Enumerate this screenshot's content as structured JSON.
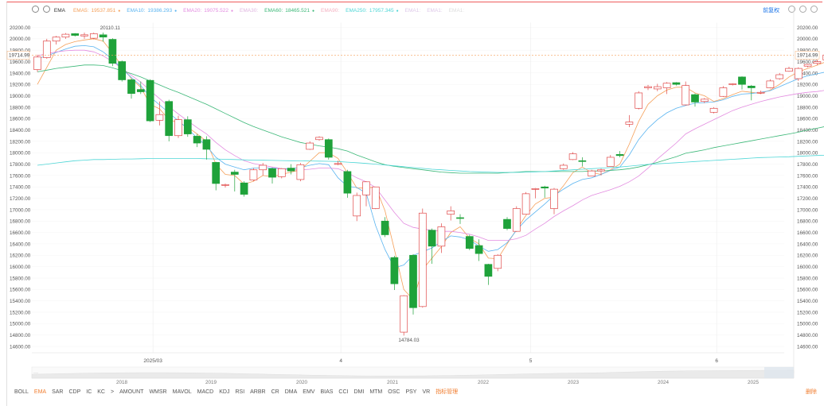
{
  "toolbar": {
    "indicator": "EMA",
    "items": [
      {
        "label": "EMA5:",
        "value": "19537.851",
        "color": "#f5a05a"
      },
      {
        "label": "EMA10:",
        "value": "19386.293",
        "color": "#5ab4f0"
      },
      {
        "label": "EMA20:",
        "value": "19075.522",
        "color": "#e38ce0"
      },
      {
        "label": "EMA30:",
        "value": "",
        "color": "#e0b6e0"
      },
      {
        "label": "EMA60:",
        "value": "18465.521",
        "color": "#3cb878"
      },
      {
        "label": "EMA90:",
        "value": "",
        "color": "#f4b0c0"
      },
      {
        "label": "EMA250:",
        "value": "17957.345",
        "color": "#4dd6d6"
      },
      {
        "label": "EMA1:",
        "value": "",
        "color": "#ddc8e8"
      },
      {
        "label": "EMA1:",
        "value": "",
        "color": "#ddc8e8"
      },
      {
        "label": "EMA1:",
        "value": "",
        "color": "#ddd"
      }
    ],
    "right_button": "前复权"
  },
  "chart_data": {
    "type": "candlestick",
    "ylim": [
      14500,
      20300
    ],
    "y_ticks": [
      "20200.00",
      "20000.00",
      "19800.00",
      "19600.00",
      "19400.00",
      "19200.00",
      "19000.00",
      "18800.00",
      "18600.00",
      "18400.00",
      "18200.00",
      "18000.00",
      "17800.00",
      "17600.00",
      "17400.00",
      "17200.00",
      "17000.00",
      "16800.00",
      "16600.00",
      "16400.00",
      "16200.00",
      "16000.00",
      "15800.00",
      "15600.00",
      "15400.00",
      "15200.00",
      "15000.00",
      "14800.00",
      "14600.00"
    ],
    "x_labels": [
      {
        "label": "2025/03",
        "i": 12.3
      },
      {
        "label": "4",
        "i": 32.3
      },
      {
        "label": "5",
        "i": 52.5
      },
      {
        "label": "6",
        "i": 72.3
      }
    ],
    "current_price": "19714.99",
    "current_value": 19714.99,
    "max_label": "20110.11",
    "max_index": 7,
    "min_label": "14784.03",
    "min_index": 38,
    "candles": [
      [
        19460,
        19680,
        19420,
        19720
      ],
      [
        19670,
        19960,
        19650,
        20000
      ],
      [
        19960,
        20030,
        19900,
        20050
      ],
      [
        20030,
        20080,
        20000,
        20100
      ],
      [
        20090,
        20060,
        20040,
        20100
      ],
      [
        20050,
        20070,
        20000,
        20110
      ],
      [
        20010,
        20090,
        19990,
        20110
      ],
      [
        20070,
        20030,
        19950,
        20110
      ],
      [
        19990,
        19570,
        19520,
        20010
      ],
      [
        19600,
        19280,
        19250,
        19620
      ],
      [
        19280,
        19040,
        18950,
        19300
      ],
      [
        19110,
        19070,
        19030,
        19250
      ],
      [
        19270,
        18560,
        18540,
        19290
      ],
      [
        18570,
        18670,
        18480,
        18900
      ],
      [
        18900,
        18300,
        18200,
        18930
      ],
      [
        18300,
        18580,
        18260,
        18650
      ],
      [
        18580,
        18330,
        18280,
        18640
      ],
      [
        18290,
        18170,
        18100,
        18330
      ],
      [
        18230,
        18060,
        17880,
        18290
      ],
      [
        17830,
        17460,
        17340,
        17840
      ],
      [
        17440,
        17440,
        17390,
        17460
      ],
      [
        17660,
        17620,
        17320,
        17700
      ],
      [
        17470,
        17270,
        17230,
        17500
      ],
      [
        17520,
        17700,
        17500,
        17730
      ],
      [
        17700,
        17780,
        17600,
        17820
      ],
      [
        17720,
        17570,
        17460,
        17740
      ],
      [
        17580,
        17720,
        17550,
        17730
      ],
      [
        17730,
        17680,
        17620,
        17800
      ],
      [
        17530,
        17790,
        17500,
        17820
      ],
      [
        18060,
        18170,
        18050,
        18200
      ],
      [
        18230,
        18270,
        18210,
        18290
      ],
      [
        18230,
        17920,
        17880,
        18250
      ],
      [
        17800,
        17810,
        17780,
        17860
      ],
      [
        17670,
        17290,
        17210,
        17700
      ],
      [
        16890,
        17250,
        16800,
        17300
      ],
      [
        17260,
        17490,
        17060,
        17500
      ],
      [
        17020,
        17400,
        17010,
        17400
      ],
      [
        16800,
        16560,
        16520,
        16870
      ],
      [
        16160,
        15700,
        15590,
        16190
      ],
      [
        14850,
        15490,
        14790,
        15500
      ],
      [
        16200,
        15280,
        15160,
        16220
      ],
      [
        15300,
        16940,
        15280,
        17020
      ],
      [
        16640,
        16360,
        16050,
        16670
      ],
      [
        16360,
        16700,
        16240,
        16760
      ],
      [
        16920,
        16980,
        16810,
        17060
      ],
      [
        16860,
        16850,
        16750,
        16920
      ],
      [
        16530,
        16320,
        16290,
        16560
      ],
      [
        16370,
        16230,
        16100,
        16480
      ],
      [
        16040,
        15830,
        15680,
        16050
      ],
      [
        15970,
        16200,
        15920,
        16220
      ],
      [
        16830,
        16670,
        16640,
        16870
      ],
      [
        16620,
        17020,
        16610,
        17060
      ],
      [
        16920,
        17280,
        16950,
        17310
      ],
      [
        17360,
        17370,
        17200,
        17380
      ],
      [
        17400,
        17380,
        17210,
        17420
      ],
      [
        17020,
        17360,
        16920,
        17380
      ],
      [
        17720,
        17780,
        17700,
        17810
      ],
      [
        17880,
        17980,
        17870,
        18010
      ],
      [
        17860,
        17850,
        17760,
        17920
      ],
      [
        17590,
        17680,
        17640,
        17700
      ],
      [
        17680,
        17700,
        17600,
        17720
      ],
      [
        17760,
        17920,
        17780,
        17960
      ],
      [
        17970,
        17950,
        17920,
        18030
      ],
      [
        18500,
        18540,
        18450,
        18660
      ],
      [
        18780,
        19050,
        18760,
        19080
      ],
      [
        19140,
        19160,
        19100,
        19190
      ],
      [
        19120,
        19160,
        19080,
        19210
      ],
      [
        19140,
        19220,
        19030,
        19240
      ],
      [
        19230,
        19200,
        19180,
        19240
      ],
      [
        18840,
        19180,
        18830,
        19250
      ],
      [
        19020,
        18890,
        18810,
        19040
      ],
      [
        18900,
        18940,
        18870,
        18960
      ],
      [
        18710,
        18780,
        18690,
        18800
      ],
      [
        18990,
        19140,
        18980,
        19170
      ],
      [
        19200,
        19210,
        19180,
        19220
      ],
      [
        19330,
        19200,
        19110,
        19340
      ],
      [
        19170,
        19140,
        18920,
        19190
      ],
      [
        19060,
        19060,
        19030,
        19090
      ],
      [
        19140,
        19260,
        19130,
        19290
      ],
      [
        19300,
        19370,
        19280,
        19400
      ],
      [
        19430,
        19480,
        19420,
        19510
      ],
      [
        19300,
        19480,
        19260,
        19500
      ],
      [
        19520,
        19550,
        19500,
        19560
      ],
      [
        19570,
        19600,
        19540,
        19630
      ],
      [
        19630,
        19715,
        19600,
        19730
      ]
    ],
    "ema_lines": [
      {
        "name": "EMA5",
        "color": "#f5a05a",
        "values": [
          19200,
          19500,
          19800,
          19900,
          19950,
          19980,
          20000,
          19960,
          19750,
          19520,
          19300,
          19150,
          18850,
          18770,
          18580,
          18530,
          18450,
          18330,
          18200,
          17800,
          17620,
          17600,
          17450,
          17500,
          17600,
          17580,
          17620,
          17660,
          17700,
          17850,
          18000,
          18000,
          17900,
          17650,
          17380,
          17380,
          17400,
          16980,
          16300,
          15600,
          15420,
          15950,
          16150,
          16350,
          16600,
          16700,
          16500,
          16400,
          16150,
          16140,
          16400,
          16650,
          16900,
          17100,
          17200,
          17220,
          17420,
          17650,
          17750,
          17650,
          17620,
          17700,
          17800,
          18150,
          18550,
          18850,
          19000,
          19100,
          19150,
          19150,
          19050,
          19000,
          18900,
          18950,
          19020,
          19080,
          19060,
          19040,
          19100,
          19200,
          19330,
          19420,
          19480,
          19537,
          19600
        ]
      },
      {
        "name": "EMA10",
        "color": "#5ab4f0",
        "values": [
          19650,
          19700,
          19760,
          19820,
          19870,
          19880,
          19860,
          19770,
          19640,
          19470,
          19320,
          19180,
          18980,
          18840,
          18700,
          18560,
          18420,
          18260,
          18120,
          17920,
          17800,
          17750,
          17700,
          17730,
          17740,
          17730,
          17720,
          17720,
          17740,
          17780,
          17810,
          17790,
          17560,
          17410,
          17390,
          17290,
          16720,
          16300,
          15980,
          16030,
          16200,
          16260,
          16330,
          16440,
          16540,
          16520,
          16470,
          16360,
          16270,
          16300,
          16420,
          16640,
          16820,
          16960,
          17100,
          17250,
          17360,
          17460,
          17530,
          17560,
          17620,
          17690,
          17750,
          17960,
          18230,
          18430,
          18580,
          18700,
          18780,
          18830,
          18870,
          18880,
          18890,
          18930,
          18990,
          19030,
          19040,
          19060,
          19090,
          19160,
          19230,
          19300,
          19350,
          19386,
          19420
        ]
      },
      {
        "name": "EMA20",
        "color": "#e38ce0",
        "values": [
          19700,
          19740,
          19770,
          19790,
          19800,
          19800,
          19770,
          19700,
          19600,
          19480,
          19360,
          19240,
          19090,
          18950,
          18810,
          18680,
          18560,
          18440,
          18330,
          18180,
          18050,
          17950,
          17860,
          17810,
          17780,
          17750,
          17720,
          17700,
          17700,
          17710,
          17730,
          17730,
          17720,
          17650,
          17560,
          17490,
          17390,
          17170,
          16950,
          16760,
          16690,
          16660,
          16640,
          16620,
          16620,
          16600,
          16570,
          16520,
          16460,
          16460,
          16460,
          16490,
          16550,
          16660,
          16760,
          16880,
          16980,
          17070,
          17170,
          17250,
          17300,
          17350,
          17410,
          17490,
          17590,
          17730,
          17890,
          18030,
          18170,
          18330,
          18420,
          18500,
          18580,
          18660,
          18740,
          18800,
          18850,
          18900,
          18940,
          18980,
          19010,
          19040,
          19060,
          19075,
          19100
        ]
      },
      {
        "name": "EMA60",
        "color": "#3cb878",
        "values": [
          19420,
          19450,
          19480,
          19500,
          19520,
          19540,
          19540,
          19530,
          19490,
          19440,
          19390,
          19330,
          19260,
          19190,
          19120,
          19060,
          18990,
          18920,
          18850,
          18770,
          18690,
          18610,
          18530,
          18460,
          18400,
          18340,
          18280,
          18230,
          18180,
          18150,
          18120,
          18100,
          18070,
          18030,
          17960,
          17900,
          17840,
          17790,
          17760,
          17740,
          17720,
          17700,
          17680,
          17660,
          17650,
          17640,
          17640,
          17640,
          17640,
          17640,
          17650,
          17660,
          17670,
          17670,
          17670,
          17670,
          17670,
          17670,
          17670,
          17680,
          17680,
          17690,
          17700,
          17720,
          17750,
          17790,
          17830,
          17880,
          17930,
          17990,
          18020,
          18050,
          18090,
          18120,
          18150,
          18180,
          18210,
          18240,
          18270,
          18300,
          18330,
          18360,
          18400,
          18430,
          18465
        ]
      },
      {
        "name": "EMA250",
        "color": "#4dd6d6",
        "values": [
          17780,
          17800,
          17820,
          17840,
          17860,
          17870,
          17880,
          17880,
          17885,
          17890,
          17890,
          17895,
          17898,
          17900,
          17900,
          17900,
          17900,
          17898,
          17895,
          17890,
          17885,
          17880,
          17875,
          17870,
          17868,
          17865,
          17862,
          17860,
          17858,
          17855,
          17852,
          17850,
          17845,
          17835,
          17825,
          17812,
          17800,
          17785,
          17770,
          17755,
          17740,
          17725,
          17710,
          17700,
          17690,
          17680,
          17670,
          17665,
          17660,
          17655,
          17655,
          17655,
          17660,
          17665,
          17670,
          17680,
          17690,
          17700,
          17710,
          17720,
          17730,
          17740,
          17750,
          17765,
          17780,
          17795,
          17805,
          17815,
          17825,
          17835,
          17845,
          17855,
          17865,
          17875,
          17885,
          17895,
          17905,
          17915,
          17920,
          17925,
          17930,
          17938,
          17945,
          17952,
          17957
        ]
      }
    ]
  },
  "navigator": {
    "years": [
      "2018",
      "2019",
      "2020",
      "2021",
      "2022",
      "2023",
      "2024",
      "2025"
    ],
    "handle_label": "···"
  },
  "bottom_tabs": [
    "BOLL",
    "EMA",
    "SAR",
    "CDP",
    "IC",
    "KC",
    ">",
    "AMOUNT",
    "WMSR",
    "MAVOL",
    "MACD",
    "KDJ",
    "RSI",
    "ARBR",
    "CR",
    "DMA",
    "EMV",
    "BIAS",
    "CCI",
    "DMI",
    "MTM",
    "OSC",
    "PSY",
    "VR",
    "指标管理"
  ],
  "active_tab": "EMA",
  "delete_label": "删除"
}
